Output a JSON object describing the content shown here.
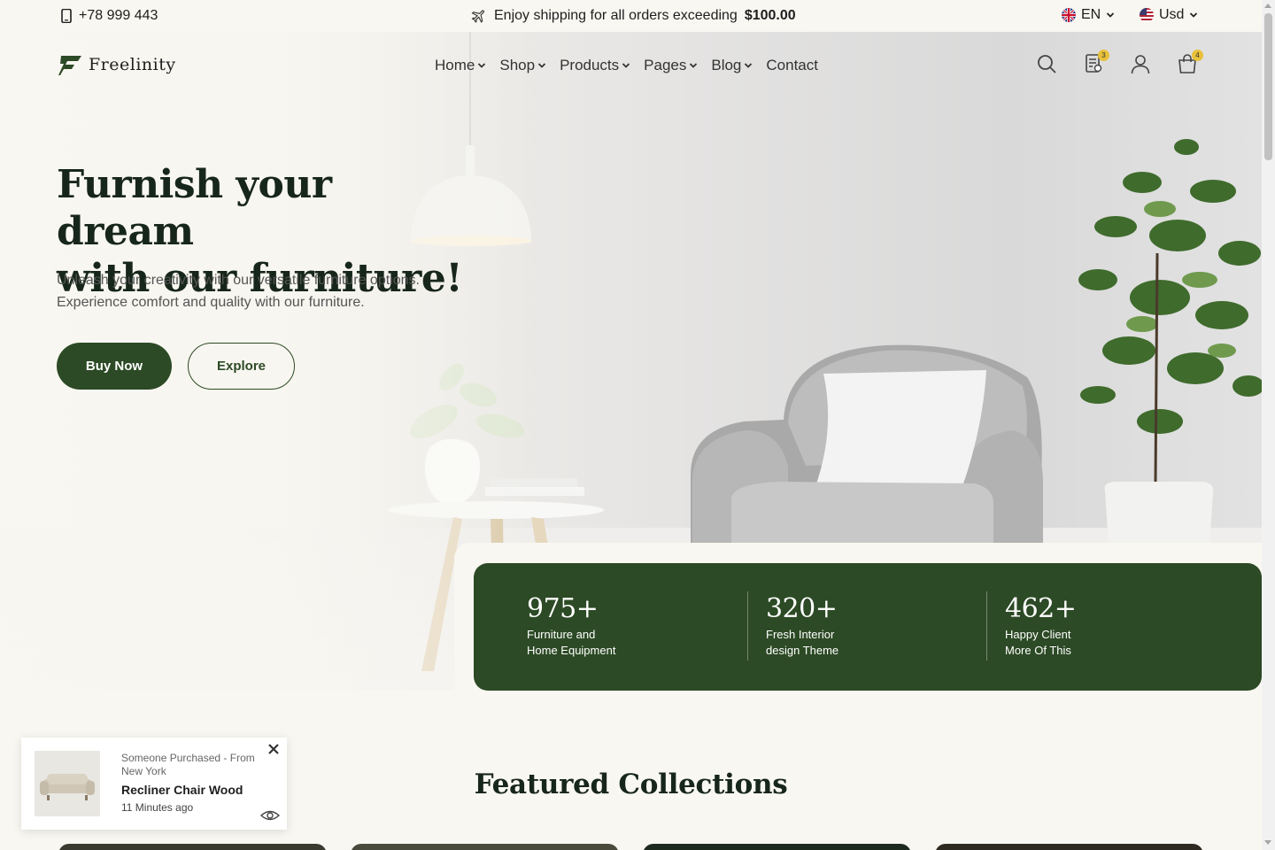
{
  "topbar": {
    "phone": "+78 999 443",
    "shipping_text": "Enjoy shipping for all orders exceeding",
    "shipping_amount": "$100.00",
    "language": "EN",
    "currency": "Usd"
  },
  "brand": {
    "name": "Freelinity"
  },
  "nav": {
    "items": [
      {
        "label": "Home",
        "has_dropdown": true
      },
      {
        "label": "Shop",
        "has_dropdown": true
      },
      {
        "label": "Products",
        "has_dropdown": true
      },
      {
        "label": "Pages",
        "has_dropdown": true
      },
      {
        "label": "Blog",
        "has_dropdown": true
      },
      {
        "label": "Contact",
        "has_dropdown": false
      }
    ]
  },
  "header_icons": {
    "search": "search-icon",
    "compare": "compare-list-icon",
    "compare_count": "3",
    "account": "user-icon",
    "cart": "shopping-bag-icon",
    "cart_count": "4"
  },
  "hero": {
    "title_line1": "Furnish your dream",
    "title_line2": "with our furniture!",
    "subtitle_line1": "Unleash your creativity with our versatile furniture options.",
    "subtitle_line2": "Experience comfort and quality with our furniture.",
    "buy_label": "Buy Now",
    "explore_label": "Explore"
  },
  "stats": [
    {
      "number": "975+",
      "line1": "Furniture and",
      "line2": "Home Equipment"
    },
    {
      "number": "320+",
      "line1": "Fresh Interior",
      "line2": "design Theme"
    },
    {
      "number": "462+",
      "line1": "Happy Client",
      "line2": "More Of This"
    }
  ],
  "featured": {
    "title": "Featured Collections"
  },
  "popup": {
    "prefix": "Someone Purchased - From New York",
    "product": "Recliner Chair Wood",
    "time": "11 Minutes ago"
  },
  "colors": {
    "primary_green": "#2c4a25",
    "background": "#f9f7f1",
    "badge_yellow": "#e8c13a",
    "heading": "#17261a"
  }
}
